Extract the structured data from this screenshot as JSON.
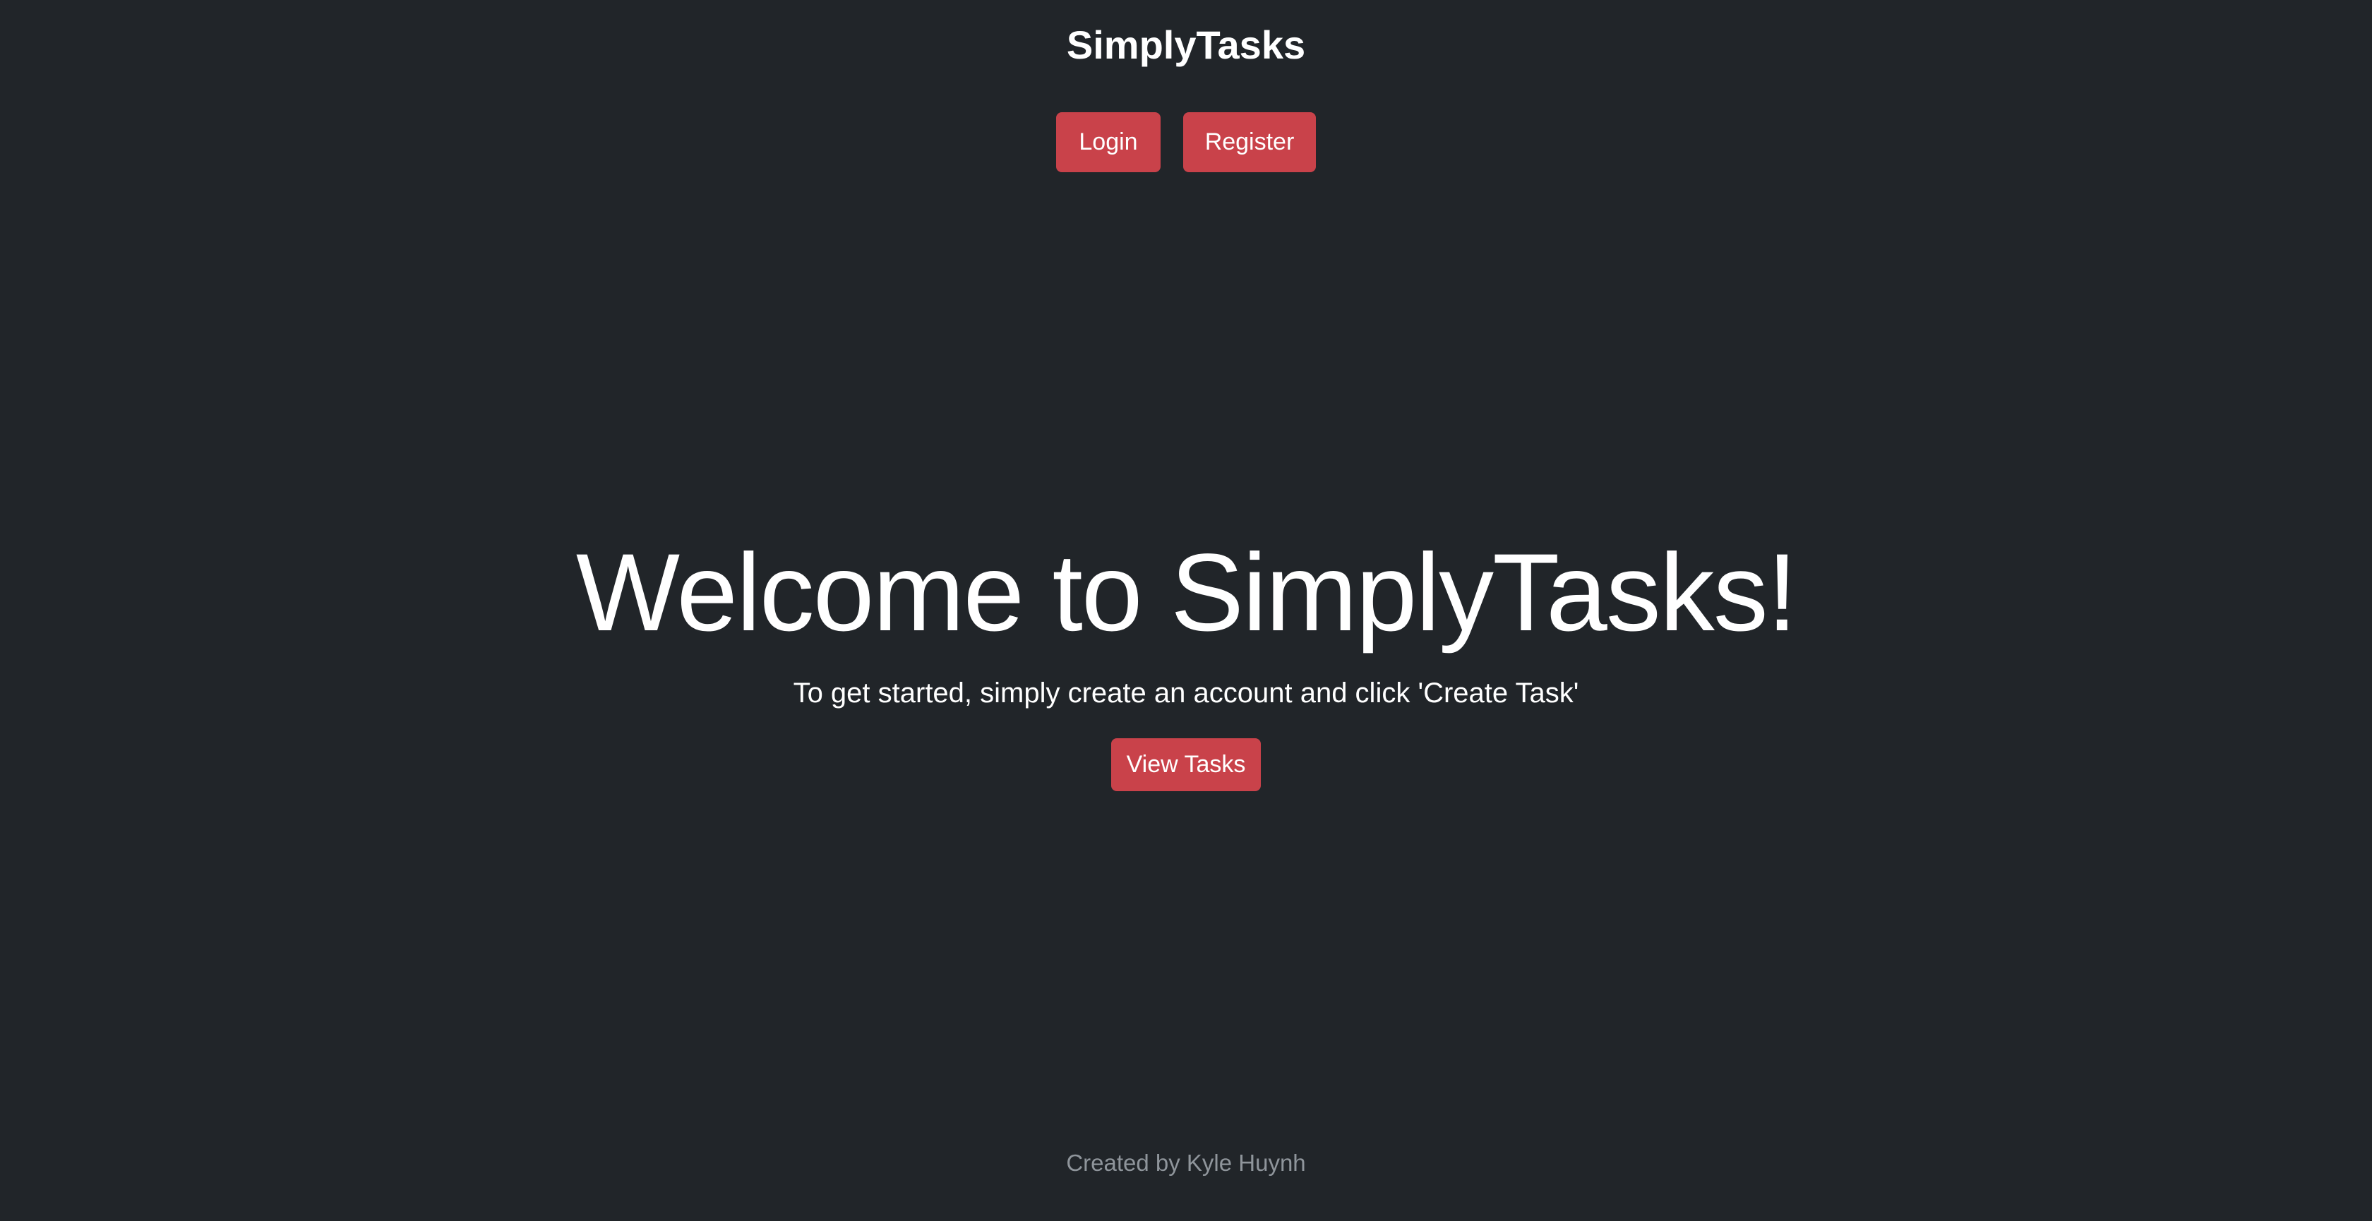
{
  "header": {
    "brand": "SimplyTasks",
    "nav": {
      "login_label": "Login",
      "register_label": "Register"
    }
  },
  "hero": {
    "title": "Welcome to SimplyTasks!",
    "subtitle": "To get started, simply create an account and click 'Create Task'",
    "view_tasks_label": "View Tasks"
  },
  "footer": {
    "credit": "Created by Kyle Huynh"
  },
  "colors": {
    "background": "#212529",
    "accent": "#c9424a",
    "text": "#ffffff",
    "muted": "#8f959b"
  }
}
